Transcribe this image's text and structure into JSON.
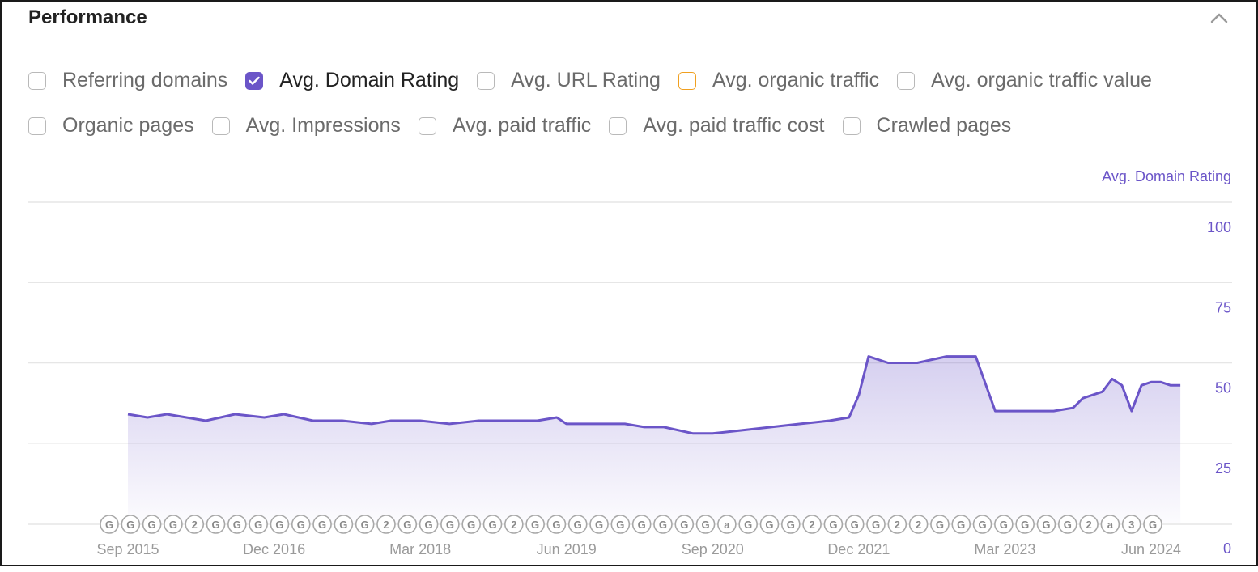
{
  "panel": {
    "title": "Performance"
  },
  "metrics_row1": [
    {
      "label": "Referring domains",
      "state": "unchecked"
    },
    {
      "label": "Avg. Domain Rating",
      "state": "checked"
    },
    {
      "label": "Avg. URL Rating",
      "state": "unchecked"
    },
    {
      "label": "Avg. organic traffic",
      "state": "highlight"
    },
    {
      "label": "Avg. organic traffic value",
      "state": "unchecked"
    }
  ],
  "metrics_row2": [
    {
      "label": "Organic pages",
      "state": "unchecked"
    },
    {
      "label": "Avg. Impressions",
      "state": "unchecked"
    },
    {
      "label": "Avg. paid traffic",
      "state": "unchecked"
    },
    {
      "label": "Avg. paid traffic cost",
      "state": "unchecked"
    },
    {
      "label": "Crawled pages",
      "state": "unchecked"
    }
  ],
  "colors": {
    "accent": "#6b55c8",
    "highlight": "#f0a020",
    "axis_text": "#6b55c8",
    "muted": "#9a9a9a"
  },
  "chart_data": {
    "type": "area",
    "series": [
      {
        "name": "Avg. Domain Rating",
        "color": "#6b55c8"
      }
    ],
    "y_axis_label": "Avg. Domain Rating",
    "ylim": [
      0,
      100
    ],
    "y_ticks": [
      "100",
      "75",
      "50",
      "25",
      "0"
    ],
    "x_tick_labels": [
      "Sep 2015",
      "Dec 2016",
      "Mar 2018",
      "Jun 2019",
      "Sep 2020",
      "Dec 2021",
      "Mar 2023",
      "Jun 2024"
    ],
    "points": [
      [
        "2015-09",
        34
      ],
      [
        "2015-11",
        33
      ],
      [
        "2016-01",
        34
      ],
      [
        "2016-03",
        33
      ],
      [
        "2016-05",
        32
      ],
      [
        "2016-08",
        34
      ],
      [
        "2016-11",
        33
      ],
      [
        "2017-01",
        34
      ],
      [
        "2017-04",
        32
      ],
      [
        "2017-07",
        32
      ],
      [
        "2017-10",
        31
      ],
      [
        "2017-12",
        32
      ],
      [
        "2018-03",
        32
      ],
      [
        "2018-06",
        31
      ],
      [
        "2018-09",
        32
      ],
      [
        "2018-12",
        32
      ],
      [
        "2019-03",
        32
      ],
      [
        "2019-05",
        33
      ],
      [
        "2019-06",
        31
      ],
      [
        "2019-09",
        31
      ],
      [
        "2019-12",
        31
      ],
      [
        "2020-02",
        30
      ],
      [
        "2020-04",
        30
      ],
      [
        "2020-07",
        28
      ],
      [
        "2020-09",
        28
      ],
      [
        "2020-12",
        29
      ],
      [
        "2021-03",
        30
      ],
      [
        "2021-06",
        31
      ],
      [
        "2021-09",
        32
      ],
      [
        "2021-11",
        33
      ],
      [
        "2021-12",
        40
      ],
      [
        "2022-01",
        52
      ],
      [
        "2022-03",
        50
      ],
      [
        "2022-06",
        50
      ],
      [
        "2022-09",
        52
      ],
      [
        "2022-12",
        52
      ],
      [
        "2023-02",
        35
      ],
      [
        "2023-05",
        35
      ],
      [
        "2023-08",
        35
      ],
      [
        "2023-10",
        36
      ],
      [
        "2023-11",
        39
      ],
      [
        "2024-01",
        41
      ],
      [
        "2024-02",
        45
      ],
      [
        "2024-03",
        43
      ],
      [
        "2024-04",
        35
      ],
      [
        "2024-05",
        43
      ],
      [
        "2024-06",
        44
      ],
      [
        "2024-07",
        44
      ],
      [
        "2024-08",
        43
      ],
      [
        "2024-09",
        43
      ]
    ],
    "annotation_markers": [
      "G",
      "G",
      "G",
      "G",
      "2",
      "G",
      "G",
      "G",
      "G",
      "G",
      "G",
      "G",
      "G",
      "2",
      "G",
      "G",
      "G",
      "G",
      "G",
      "2",
      "G",
      "G",
      "G",
      "G",
      "G",
      "G",
      "G",
      "G",
      "G",
      "a",
      "G",
      "G",
      "G",
      "2",
      "G",
      "G",
      "G",
      "2",
      "2",
      "G",
      "G",
      "G",
      "G",
      "G",
      "G",
      "G",
      "2",
      "a",
      "3",
      "G"
    ],
    "grid": true,
    "legend": "none"
  }
}
